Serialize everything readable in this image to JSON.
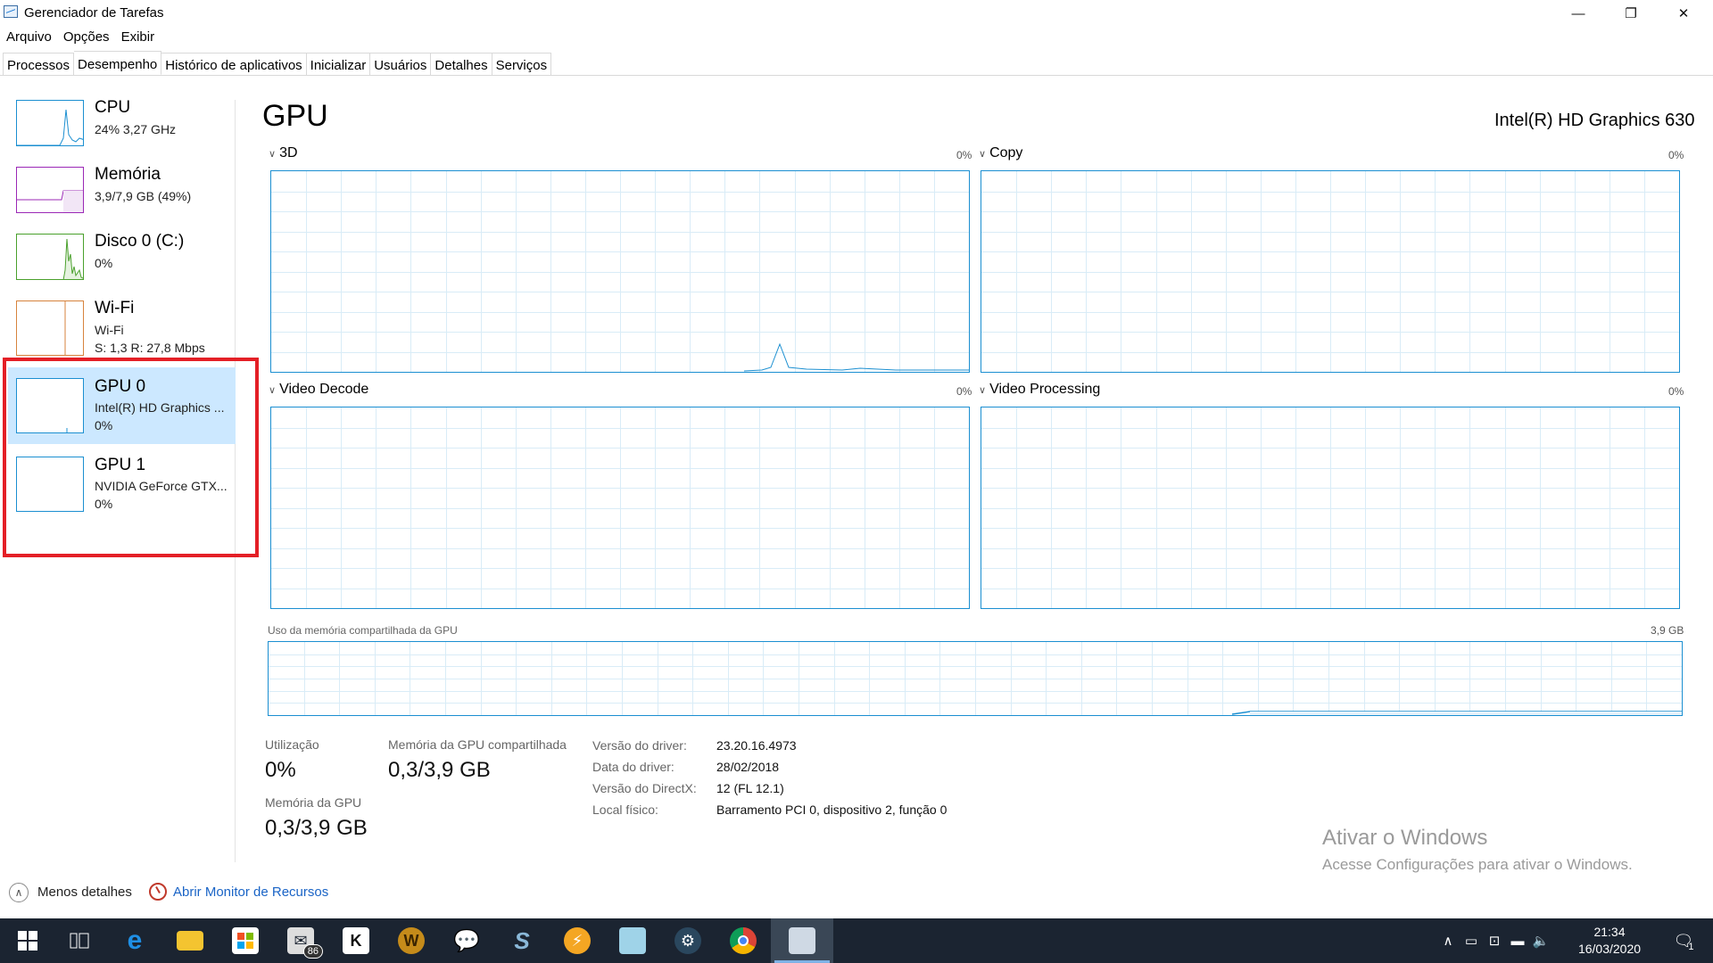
{
  "window": {
    "title": "Gerenciador de Tarefas",
    "minimize_glyph": "—",
    "maximize_glyph": "❐",
    "close_glyph": "✕"
  },
  "menu": [
    "Arquivo",
    "Opções",
    "Exibir"
  ],
  "tabs": [
    {
      "label": "Processos",
      "active": false
    },
    {
      "label": "Desempenho",
      "active": true
    },
    {
      "label": "Histórico de aplicativos",
      "active": false
    },
    {
      "label": "Inicializar",
      "active": false
    },
    {
      "label": "Usuários",
      "active": false
    },
    {
      "label": "Detalhes",
      "active": false
    },
    {
      "label": "Serviços",
      "active": false
    }
  ],
  "resources": [
    {
      "name": "CPU",
      "line1": "24%  3,27 GHz",
      "line2": "",
      "color": "#1b8fd1"
    },
    {
      "name": "Memória",
      "line1": "3,9/7,9 GB (49%)",
      "line2": "",
      "color": "#9b28b6"
    },
    {
      "name": "Disco 0 (C:)",
      "line1": "0%",
      "line2": "",
      "color": "#4aa02c"
    },
    {
      "name": "Wi-Fi",
      "line1": "Wi-Fi",
      "line2": "S: 1,3  R: 27,8 Mbps",
      "color": "#d7833d"
    },
    {
      "name": "GPU 0",
      "line1": "Intel(R) HD Graphics ...",
      "line2": "0%",
      "color": "#1b8fd1",
      "selected": true
    },
    {
      "name": "GPU 1",
      "line1": "NVIDIA GeForce GTX...",
      "line2": "0%",
      "color": "#1b8fd1"
    }
  ],
  "main": {
    "title": "GPU",
    "model": "Intel(R) HD Graphics 630",
    "graphs": [
      {
        "label": "3D",
        "percent": "0%"
      },
      {
        "label": "Copy",
        "percent": "0%"
      },
      {
        "label": "Video Decode",
        "percent": "0%"
      },
      {
        "label": "Video Processing",
        "percent": "0%"
      }
    ],
    "shared_memory": {
      "label": "Uso da memória compartilhada da GPU",
      "max": "3,9 GB"
    },
    "stats": {
      "utilization_label": "Utilização",
      "utilization_value": "0%",
      "shared_gpu_mem_label": "Memória da GPU compartilhada",
      "shared_gpu_mem_value": "0,3/3,9 GB",
      "gpu_mem_label": "Memória da GPU",
      "gpu_mem_value": "0,3/3,9 GB"
    },
    "details": [
      {
        "key": "Versão do driver:",
        "value": "23.20.16.4973"
      },
      {
        "key": "Data do driver:",
        "value": "28/02/2018"
      },
      {
        "key": "Versão do DirectX:",
        "value": "12 (FL 12.1)"
      },
      {
        "key": "Local físico:",
        "value": "Barramento PCI 0, dispositivo 2, função 0"
      }
    ]
  },
  "watermark": {
    "title": "Ativar o Windows",
    "subtitle": "Acesse Configurações para ativar o Windows."
  },
  "footer": {
    "less_details": "Menos detalhes",
    "open_monitor": "Abrir Monitor de Recursos"
  },
  "taskbar": {
    "mail_badge": "86",
    "time": "21:34",
    "date": "16/03/2020",
    "notifications": "1"
  }
}
